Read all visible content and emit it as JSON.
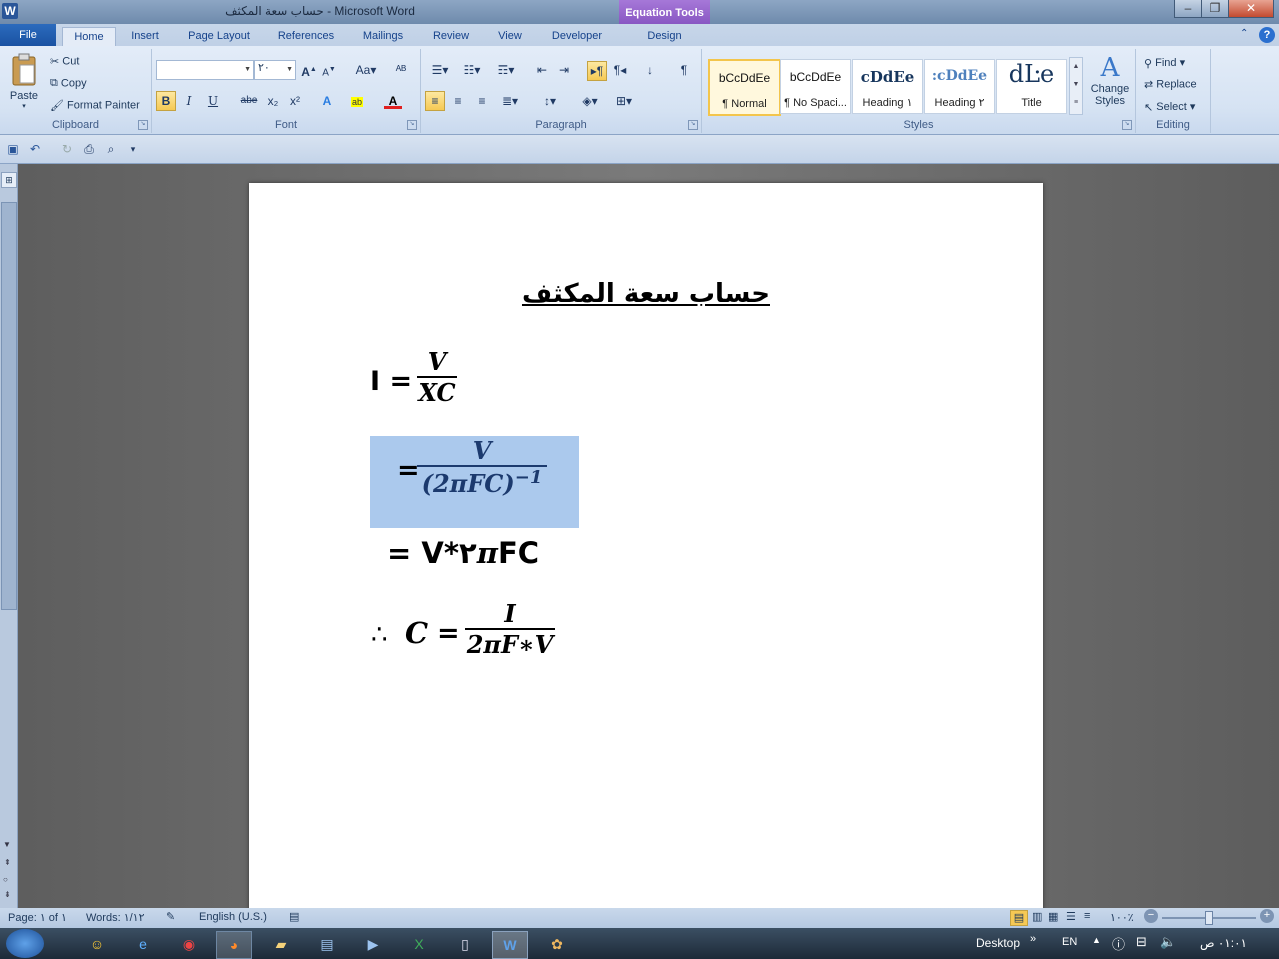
{
  "window": {
    "title": "حساب سعة المكثف - Microsoft Word",
    "contextual_tab_group": "Equation Tools"
  },
  "tabs": [
    "File",
    "Home",
    "Insert",
    "Page Layout",
    "References",
    "Mailings",
    "Review",
    "View",
    "Developer",
    "Design"
  ],
  "clipboard": {
    "paste": "Paste",
    "cut": "Cut",
    "copy": "Copy",
    "format_painter": "Format Painter",
    "label": "Clipboard"
  },
  "font": {
    "name_value": "",
    "size_value": "٢٠",
    "label": "Font",
    "bold": "B",
    "italic": "I",
    "underline": "U",
    "strike": "abe",
    "subscript": "x₂",
    "superscript": "x²",
    "change_case": "Aa",
    "grow": "A",
    "shrink": "A"
  },
  "paragraph": {
    "label": "Paragraph",
    "pilcrow": "¶"
  },
  "styles": {
    "label": "Styles",
    "items": [
      {
        "sample": "bCcDdEe",
        "name": "¶ Normal"
      },
      {
        "sample": "bCcDdEe",
        "name": "¶ No Spaci..."
      },
      {
        "sample": "cDdEe",
        "name": "Heading ١"
      },
      {
        "sample": ":cDdEe",
        "name": "Heading ٢"
      },
      {
        "sample": "dĿe",
        "name": "Title"
      }
    ],
    "change_styles": "Change Styles"
  },
  "editing": {
    "label": "Editing",
    "find": "Find",
    "replace": "Replace",
    "select": "Select"
  },
  "document": {
    "heading": "حساب سعة المكثف",
    "eq1_lhs": "I =",
    "eq1_num": "V",
    "eq1_den": "XC",
    "eq2_lhs": "=",
    "eq2_num": "V",
    "eq2_den": "(2πFC)",
    "eq2_exp": "−1",
    "eq3": "= V*٢",
    "eq3_pi": "π",
    "eq3_tail": "FC",
    "eq4_therefore": "∴",
    "eq4_lhs": "C",
    "eq4_eq": "=",
    "eq4_num": "I",
    "eq4_den": "2πF∗V"
  },
  "status": {
    "page": "Page: ١ of ١",
    "words": "Words: ١/١٢",
    "language": "English (U.S.)",
    "zoom": "١٠٠٪"
  },
  "taskbar": {
    "desktop": "Desktop",
    "lang": "EN",
    "time": "٠١:٠١ ص"
  },
  "colors": {
    "accent": "#2b6bbd",
    "equation_highlight": "#abc9ed",
    "ribbon": "#dbe6f4"
  }
}
